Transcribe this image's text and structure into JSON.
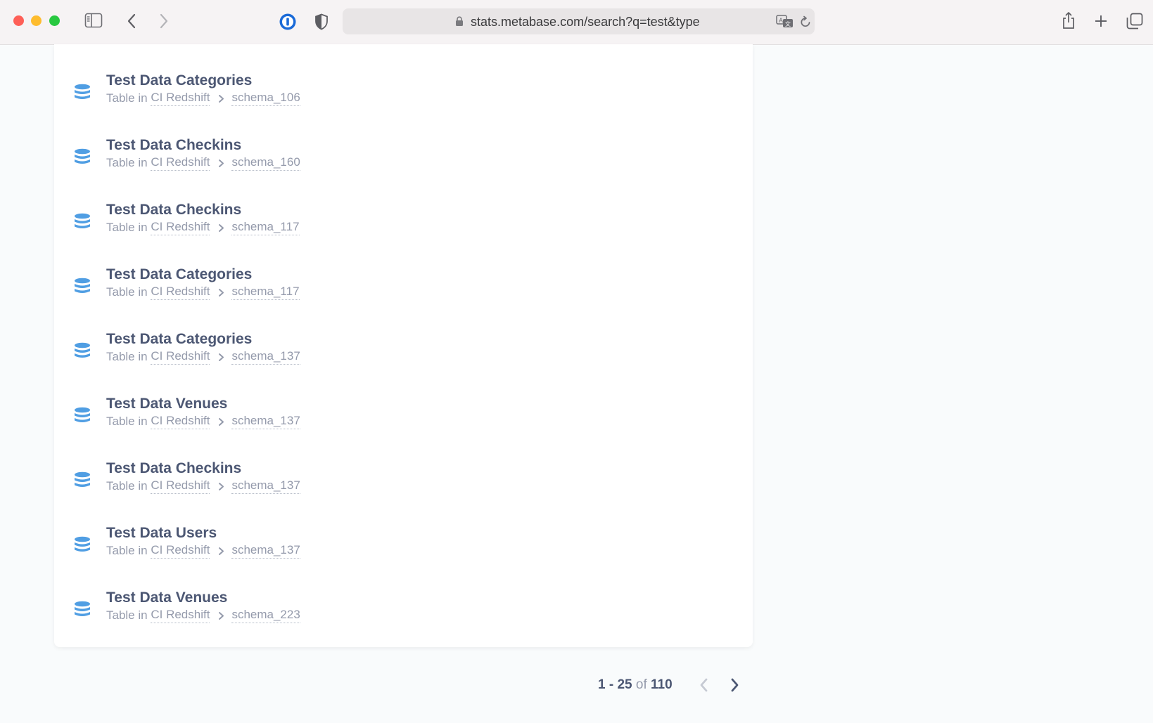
{
  "browser": {
    "url": "stats.metabase.com/search?q=test&type"
  },
  "results": [
    {
      "title": "Test Data Categories",
      "type_prefix": "Table in",
      "database": "CI Redshift",
      "schema": "schema_106"
    },
    {
      "title": "Test Data Checkins",
      "type_prefix": "Table in",
      "database": "CI Redshift",
      "schema": "schema_160"
    },
    {
      "title": "Test Data Checkins",
      "type_prefix": "Table in",
      "database": "CI Redshift",
      "schema": "schema_117"
    },
    {
      "title": "Test Data Categories",
      "type_prefix": "Table in",
      "database": "CI Redshift",
      "schema": "schema_117"
    },
    {
      "title": "Test Data Categories",
      "type_prefix": "Table in",
      "database": "CI Redshift",
      "schema": "schema_137"
    },
    {
      "title": "Test Data Venues",
      "type_prefix": "Table in",
      "database": "CI Redshift",
      "schema": "schema_137"
    },
    {
      "title": "Test Data Checkins",
      "type_prefix": "Table in",
      "database": "CI Redshift",
      "schema": "schema_137"
    },
    {
      "title": "Test Data Users",
      "type_prefix": "Table in",
      "database": "CI Redshift",
      "schema": "schema_137"
    },
    {
      "title": "Test Data Venues",
      "type_prefix": "Table in",
      "database": "CI Redshift",
      "schema": "schema_223"
    }
  ],
  "pagination": {
    "range": "1 - 25",
    "of_label": "of",
    "total": "110"
  },
  "colors": {
    "accent": "#509ee3",
    "title": "#4c5773",
    "muted": "#949aab"
  },
  "icons": {
    "result": "database-icon",
    "separator": "chevron-right-icon"
  }
}
